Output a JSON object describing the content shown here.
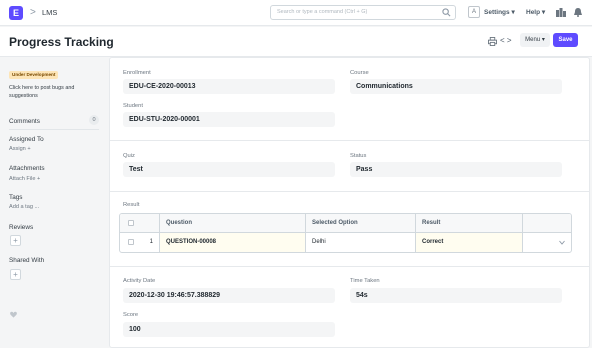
{
  "navbar": {
    "brand_letter": "E",
    "breadcrumb_sep": ">",
    "breadcrumb": "LMS",
    "search_placeholder": "Search or type a command (Ctrl + G)",
    "avatar_letter": "A",
    "settings_label": "Settings",
    "help_label": "Help"
  },
  "header": {
    "title": "Progress Tracking",
    "prev_next": "< >",
    "menu_label": "Menu",
    "save_label": "Save"
  },
  "sidebar": {
    "badge": "Under Development",
    "bug_line1": "Click here to post bugs and",
    "bug_line2": "suggestions",
    "comments_label": "Comments",
    "comments_count": "0",
    "assigned_to_label": "Assigned To",
    "assign_link": "Assign +",
    "attachments_label": "Attachments",
    "attach_link": "Attach File +",
    "tags_label": "Tags",
    "add_tag_link": "Add a tag ...",
    "reviews_label": "Reviews",
    "shared_with_label": "Shared With",
    "plus": "+"
  },
  "form": {
    "enrollment_label": "Enrollment",
    "enrollment_value": "EDU-CE-2020-00013",
    "course_label": "Course",
    "course_value": "Communications",
    "student_label": "Student",
    "student_value": "EDU-STU-2020-00001",
    "quiz_label": "Quiz",
    "quiz_value": "Test",
    "status_label": "Status",
    "status_value": "Pass",
    "result_label": "Result",
    "result_table": {
      "columns": [
        "Question",
        "Selected Option",
        "Result"
      ],
      "rows": [
        {
          "index": "1",
          "question": "QUESTION-00008",
          "selected_option": "Delhi",
          "result": "Correct"
        }
      ]
    },
    "activity_date_label": "Activity Date",
    "activity_date_value": "2020-12-30 19:46:57.388829",
    "time_taken_label": "Time Taken",
    "time_taken_value": "54s",
    "score_label": "Score",
    "score_value": "100"
  },
  "colors": {
    "accent": "#5e4bff",
    "badge_bg": "#fde5b7"
  },
  "icons": [
    "search-icon",
    "notification-icon",
    "bell-icon",
    "print-icon",
    "heart-icon",
    "chevron-down-icon",
    "checkbox-icon"
  ]
}
